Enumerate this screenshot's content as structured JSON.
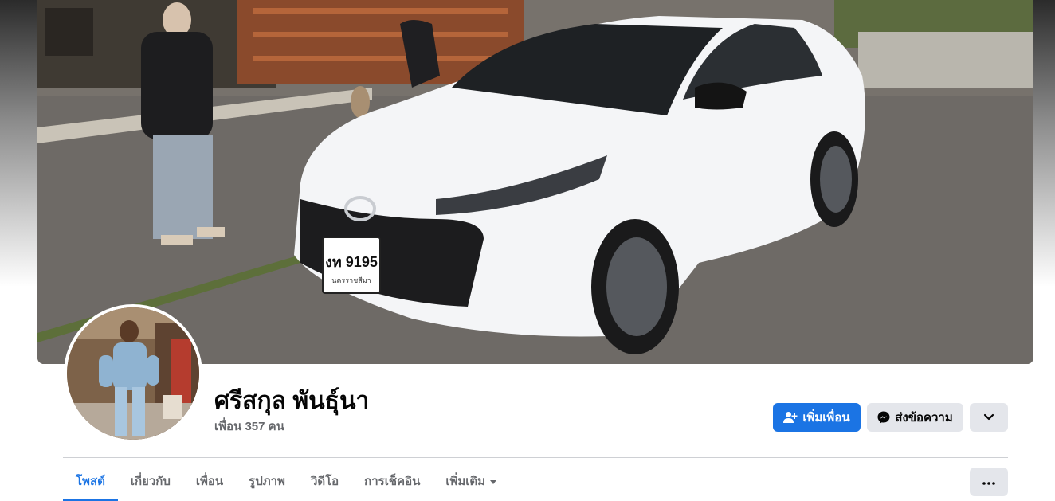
{
  "profile": {
    "name": "ศรีสกุล พันธุ์นา",
    "friends_count": "เพื่อน 357 คน",
    "cover_description": "white-car-cover-photo",
    "plate_text": "งท 9195",
    "plate_subtext": "นครราชสีมา"
  },
  "actions": {
    "add_friend_label": "เพิ่มเพื่อน",
    "message_label": "ส่งข้อความ"
  },
  "tabs": [
    {
      "label": "โพสต์",
      "active": true
    },
    {
      "label": "เกี่ยวกับ",
      "active": false
    },
    {
      "label": "เพื่อน",
      "active": false
    },
    {
      "label": "รูปภาพ",
      "active": false
    },
    {
      "label": "วิดีโอ",
      "active": false
    },
    {
      "label": "การเช็คอิน",
      "active": false
    },
    {
      "label": "เพิ่มเติม",
      "active": false
    }
  ],
  "icons": {
    "add_friend": "add-person-icon",
    "message": "messenger-icon",
    "dropdown": "chevron-down-icon",
    "more": "ellipsis-icon"
  },
  "colors": {
    "accent": "#1b74e4",
    "secondary_button": "#e4e6eb",
    "muted_text": "#65676b"
  }
}
